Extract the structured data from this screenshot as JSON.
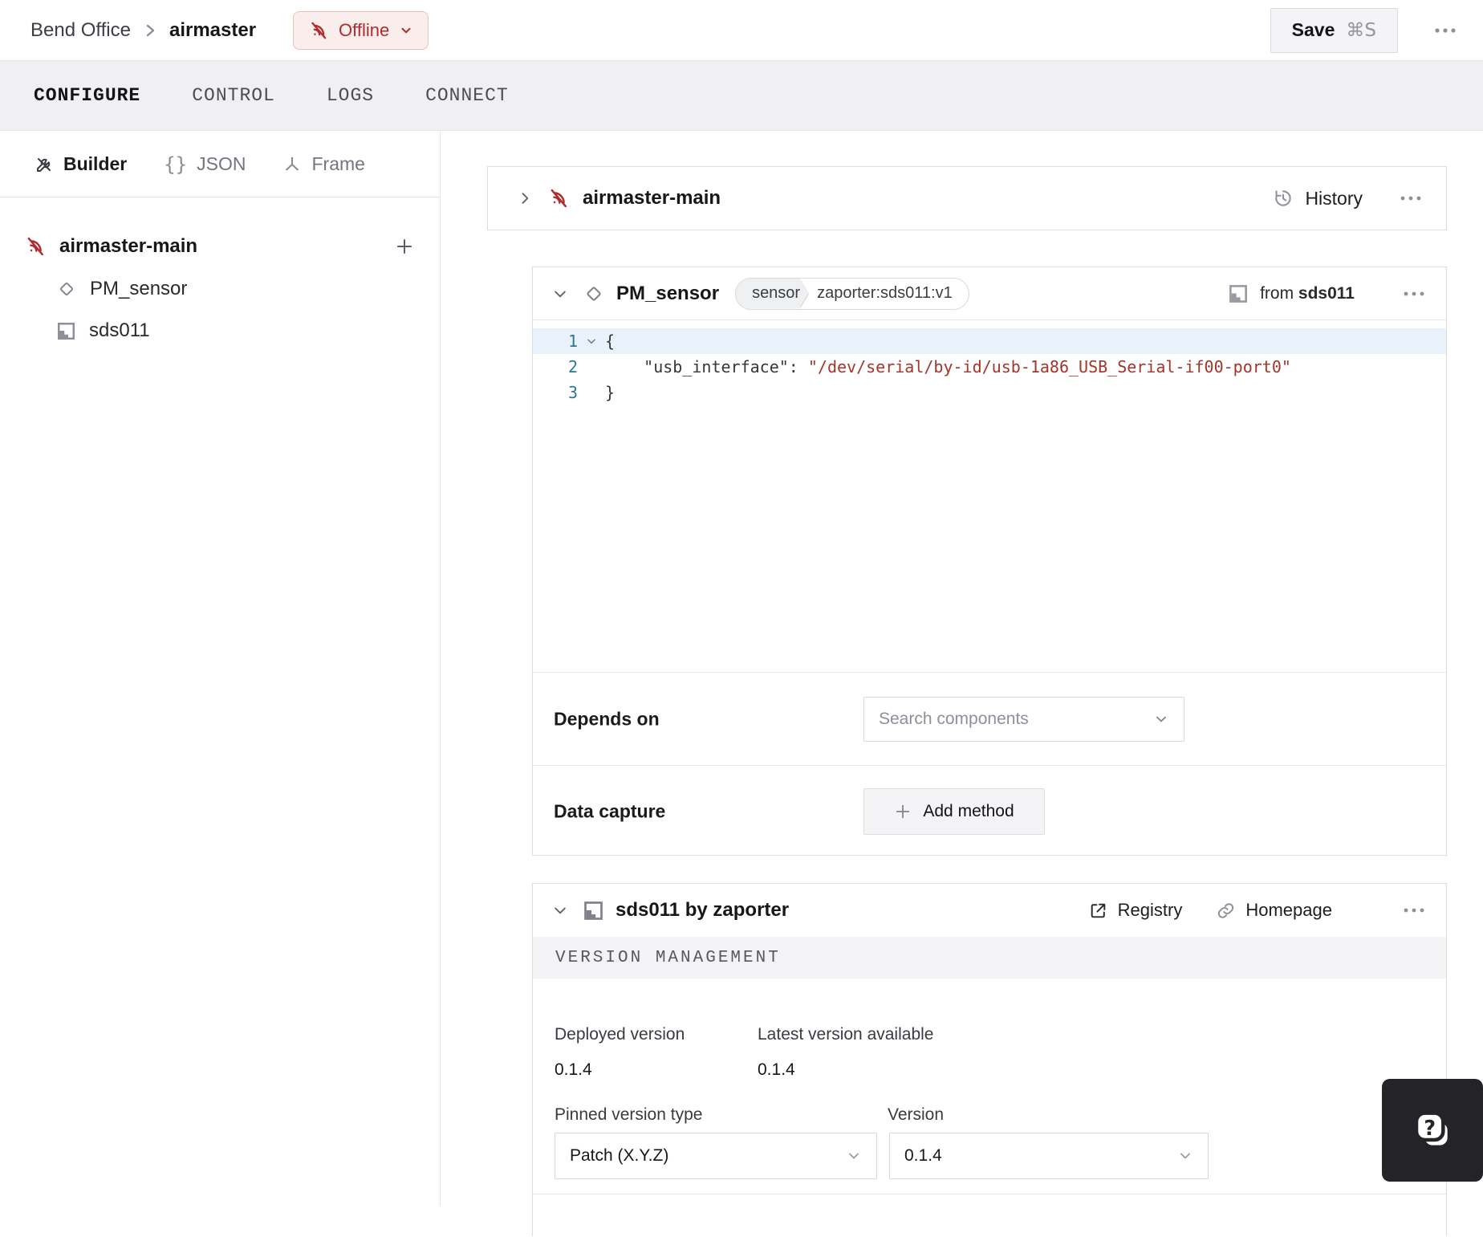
{
  "colors": {
    "status_red": "#b02a2e",
    "status_bg": "#faeeec",
    "code_string": "#a3352b",
    "line_number": "#2c7796",
    "active_line_bg": "#e9f2fa"
  },
  "header": {
    "breadcrumb_location": "Bend Office",
    "breadcrumb_machine": "airmaster",
    "status_label": "Offline",
    "save_label": "Save",
    "save_shortcut": "⌘S"
  },
  "tabs": [
    {
      "label": "CONFIGURE",
      "active": true
    },
    {
      "label": "CONTROL",
      "active": false
    },
    {
      "label": "LOGS",
      "active": false
    },
    {
      "label": "CONNECT",
      "active": false
    }
  ],
  "sidebar": {
    "modes": [
      {
        "label": "Builder"
      },
      {
        "label": "JSON",
        "icon_glyph": "{}"
      },
      {
        "label": "Frame"
      }
    ],
    "tree": {
      "root_label": "airmaster-main",
      "children": [
        {
          "label": "PM_sensor"
        },
        {
          "label": "sds011"
        }
      ]
    }
  },
  "main": {
    "machine_card": {
      "title": "airmaster-main",
      "history_label": "History"
    },
    "component_card": {
      "title": "PM_sensor",
      "type_label": "sensor",
      "model_label": "zaporter:sds011:v1",
      "from_prefix": "from",
      "from_module": "sds011",
      "code": {
        "lines": [
          {
            "num": "1",
            "text": "{"
          },
          {
            "num": "2",
            "key": "    \"usb_interface\"",
            "sep": ": ",
            "value": "\"/dev/serial/by-id/usb-1a86_USB_Serial-if00-port0\""
          },
          {
            "num": "3",
            "text": "}"
          }
        ]
      },
      "depends_on_label": "Depends on",
      "depends_on_placeholder": "Search components",
      "data_capture_label": "Data capture",
      "add_method_label": "Add method"
    },
    "module_card": {
      "title": "sds011 by zaporter",
      "registry_label": "Registry",
      "homepage_label": "Homepage",
      "section_title": "VERSION MANAGEMENT",
      "deployed_version_label": "Deployed version",
      "deployed_version": "0.1.4",
      "latest_version_label": "Latest version available",
      "latest_version": "0.1.4",
      "pinned_type_label": "Pinned version type",
      "pinned_type_value": "Patch (X.Y.Z)",
      "version_label": "Version",
      "version_value": "0.1.4"
    }
  }
}
